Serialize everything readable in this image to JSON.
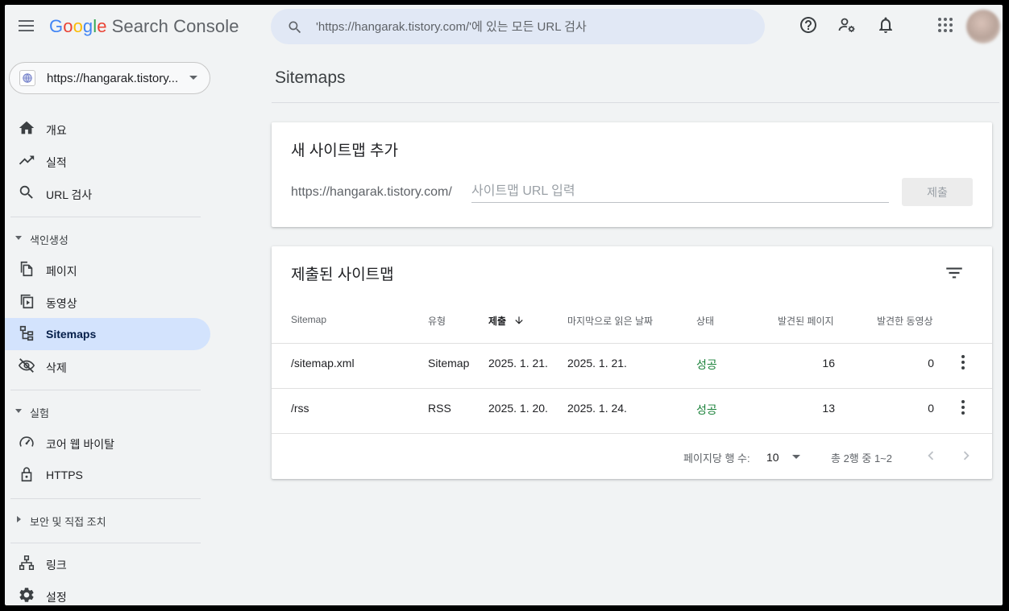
{
  "app": {
    "logo_letters": [
      "G",
      "o",
      "o",
      "g",
      "l",
      "e"
    ],
    "logo_suffix": "Search Console"
  },
  "search": {
    "placeholder": "'https://hangarak.tistory.com/'에 있는 모든 URL 검사"
  },
  "property": {
    "label": "https://hangarak.tistory..."
  },
  "sidebar": {
    "items_top": [
      {
        "label": "개요",
        "icon": "home-icon"
      },
      {
        "label": "실적",
        "icon": "trending-up-icon"
      },
      {
        "label": "URL 검사",
        "icon": "search-icon"
      }
    ],
    "section_indexing": "색인생성",
    "items_indexing": [
      {
        "label": "페이지",
        "icon": "pages-icon"
      },
      {
        "label": "동영상",
        "icon": "video-icon"
      },
      {
        "label": "Sitemaps",
        "icon": "sitemap-icon",
        "active": true
      },
      {
        "label": "삭제",
        "icon": "visibility-off-icon"
      }
    ],
    "section_experience": "실험",
    "items_experience": [
      {
        "label": "코어 웹 바이탈",
        "icon": "speed-icon"
      },
      {
        "label": "HTTPS",
        "icon": "lock-icon"
      }
    ],
    "section_security": "보안 및 직접 조치",
    "items_bottom": [
      {
        "label": "링크",
        "icon": "links-icon"
      },
      {
        "label": "설정",
        "icon": "gear-icon"
      }
    ]
  },
  "main": {
    "title": "Sitemaps",
    "add_card": {
      "title": "새 사이트맵 추가",
      "prefix": "https://hangarak.tistory.com/",
      "input_placeholder": "사이트맵 URL 입력",
      "submit_label": "제출"
    },
    "list_card": {
      "title": "제출된 사이트맵",
      "columns": [
        "Sitemap",
        "유형",
        "제출",
        "마지막으로 읽은 날짜",
        "상태",
        "발견된 페이지",
        "발견한 동영상"
      ],
      "rows": [
        {
          "sitemap": "/sitemap.xml",
          "type": "Sitemap",
          "submitted": "2025. 1. 21.",
          "last_read": "2025. 1. 21.",
          "status": "성공",
          "pages": "16",
          "videos": "0"
        },
        {
          "sitemap": "/rss",
          "type": "RSS",
          "submitted": "2025. 1. 20.",
          "last_read": "2025. 1. 24.",
          "status": "성공",
          "pages": "13",
          "videos": "0"
        }
      ],
      "pager": {
        "rows_per_page_label": "페이지당 행 수:",
        "rows_per_page_value": "10",
        "range_text": "총 2행 중 1~2"
      }
    }
  },
  "colors": {
    "accent": "#1a73e8",
    "active_nav": "#d3e3fd",
    "status_ok": "#188038",
    "background": "#f1f3f4"
  }
}
